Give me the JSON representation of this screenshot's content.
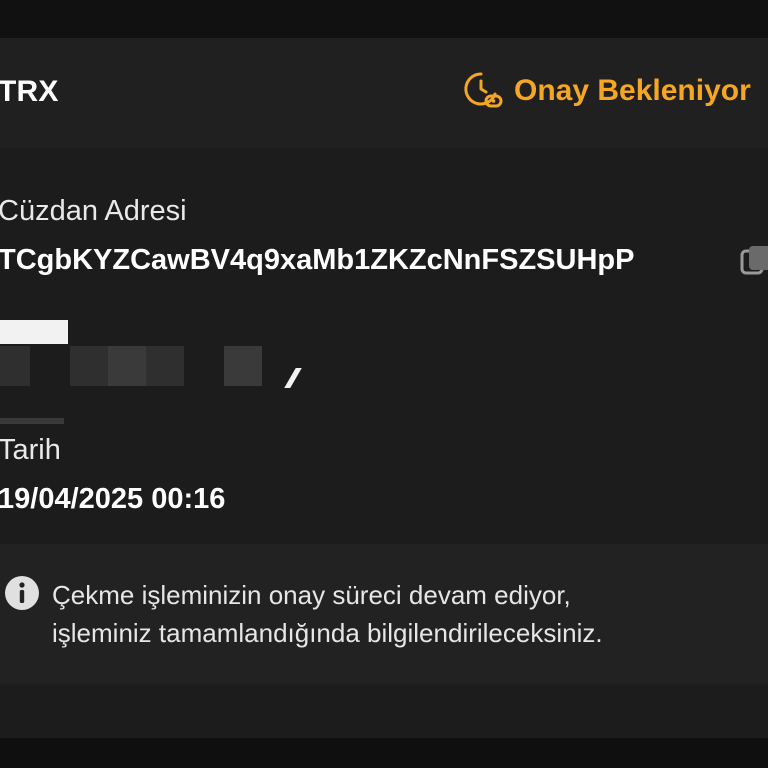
{
  "header": {
    "coin": "TRX",
    "status": "Onay Bekleniyor",
    "status_icon": "clock-pending-icon",
    "status_color": "#f5a623"
  },
  "details": {
    "wallet_label": "Cüzdan Adresi",
    "wallet_address": "TCgbKYZCawBV4q9xaMb1ZKZcNnFSZSUHpP",
    "copy_icon": "copy-icon",
    "date_label": "Tarih",
    "date_value": "19/04/2025 00:16"
  },
  "info": {
    "icon": "info-icon",
    "line1": "Çekme işleminizin onay süreci devam ediyor,",
    "line2": "işleminiz tamamlandığında bilgilendirileceksiniz."
  }
}
